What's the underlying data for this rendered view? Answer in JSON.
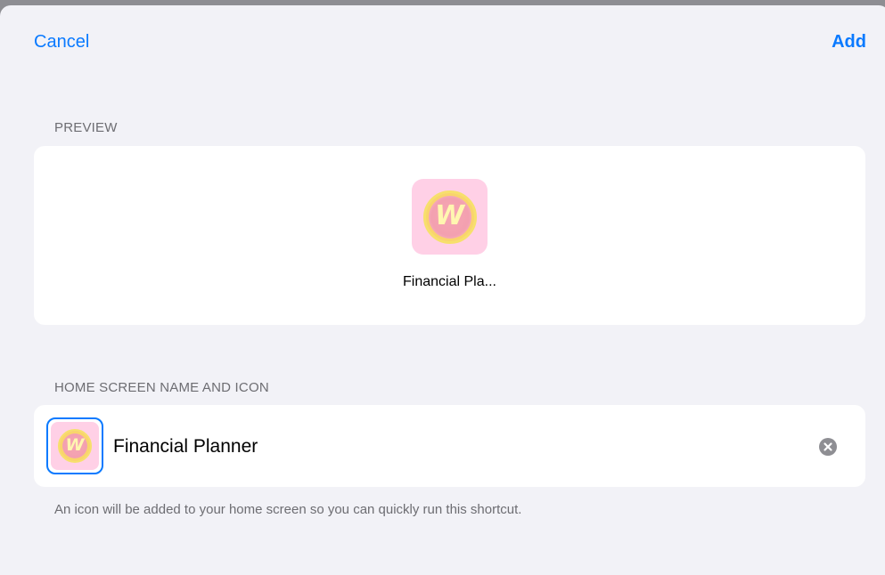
{
  "nav": {
    "cancel_label": "Cancel",
    "add_label": "Add"
  },
  "preview": {
    "section_title": "PREVIEW",
    "icon_letter": "W",
    "app_label": "Financial Pla..."
  },
  "home_screen": {
    "section_title": "HOME SCREEN NAME AND ICON",
    "icon_letter": "W",
    "name_value": "Financial Planner",
    "clear_icon": "clear-icon",
    "footer_note": "An icon will be added to your home screen so you can quickly run this shortcut."
  },
  "colors": {
    "accent": "#0a7aff",
    "background": "#f2f2f7",
    "card": "#ffffff",
    "secondary_text": "#6d6d72",
    "icon_background": "#ffd0e6"
  }
}
